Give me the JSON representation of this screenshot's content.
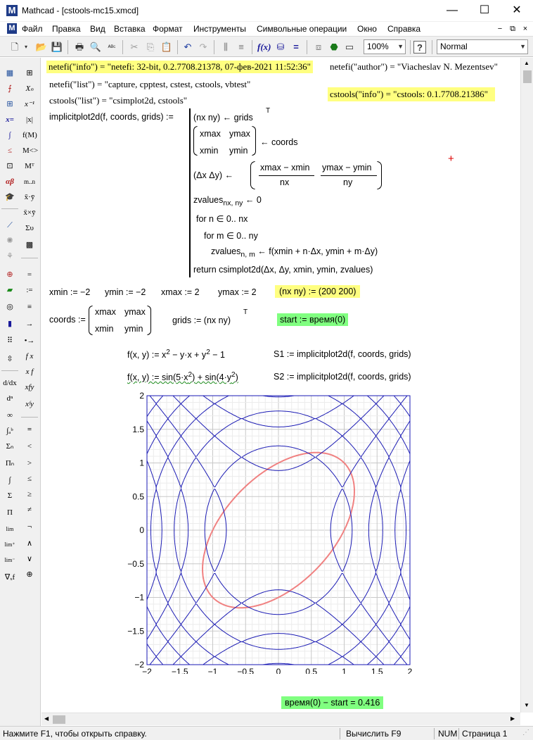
{
  "window": {
    "title": "Mathcad - [cstools-mc15.xmcd]",
    "app_icon": "M",
    "doc_icon": "M",
    "minimize": "—",
    "maximize": "☐",
    "close": "✕"
  },
  "menu": [
    "Файл",
    "Правка",
    "Вид",
    "Вставка",
    "Формат",
    "Инструменты",
    "Символьные операции",
    "Окно",
    "Справка"
  ],
  "toolbar": {
    "zoom": "100%",
    "style": "Normal"
  },
  "worksheet": {
    "netefi_info": "netefi(\"info\") = \"netefi: 32-bit, 0.2.7708.21378, 07-фев-2021 11:52:36\"",
    "netefi_author": "netefi(\"author\") = \"Viacheslav N. Mezentsev\"",
    "netefi_list": "netefi(\"list\") = \"capture, cpptest, cstest, cstools, vbtest\"",
    "cstools_info": "cstools(\"info\") = \"cstools: 0.1.7708.21386\"",
    "cstools_list": "cstools(\"list\") = \"csimplot2d, cstools\"",
    "fn_def": "implicitplot2d(f, coords, grids) :=",
    "prog": {
      "l1": "(nx   ny) ← grids",
      "l1_sup": "T",
      "m_xmax": "xmax",
      "m_ymax": "ymax",
      "m_xmin": "xmin",
      "m_ymin": "ymin",
      "coords_arrow": "← coords",
      "l3_left": "(Δx   Δy) ←",
      "l3_n1": "xmax − xmin",
      "l3_d1": "nx",
      "l3_n2": "ymax − ymin",
      "l3_d2": "ny",
      "l4": "zvalues",
      "l4_sub": "nx, ny",
      "l4_rest": " ← 0",
      "l5": "for   n ∈ 0.. nx",
      "l6": "for   m ∈ 0.. ny",
      "l7": "zvalues",
      "l7_sub": "n, m",
      "l7_rest": " ← f(xmin + n·Δx, ymin + m·Δy)",
      "l8": "return   csimplot2d(Δx, Δy, xmin, ymin, zvalues)"
    },
    "xmin": "xmin := −2",
    "ymin": "ymin := −2",
    "xmax": "xmax := 2",
    "ymax": "ymax := 2",
    "nxny": "(nx   ny) := (200   200)",
    "coords_lhs": "coords :=",
    "grids": "grids := (nx   ny)",
    "grids_sup": "T",
    "start": "start := время(0)",
    "f1": "f(x, y) := x",
    "f1_sup1": "2",
    "f1_mid": " − y·x + y",
    "f1_sup2": "2",
    "f1_end": " − 1",
    "s1": "S1 := implicitplot2d(f, coords, grids)",
    "f2": "f(x, y) := sin",
    "f2_a": "5·x",
    "f2_sup1": "2",
    "f2_mid": " + sin",
    "f2_b": "4·y",
    "f2_sup2": "2",
    "s2": "S2 := implicitplot2d(f, coords, grids)",
    "elapsed": "время(0) − start = 0.416"
  },
  "chart_data": {
    "type": "line",
    "title": "",
    "xlabel": "",
    "ylabel": "",
    "xlim": [
      -2,
      2
    ],
    "ylim": [
      -2,
      2
    ],
    "grid": true,
    "xticks": [
      "−2",
      "−1.5",
      "−1",
      "−0.5",
      "0",
      "0.5",
      "1",
      "1.5",
      "2"
    ],
    "yticks": [
      "2",
      "1.5",
      "1",
      "0.5",
      "0",
      "−0.5",
      "−1",
      "−1.5",
      "−2"
    ],
    "series": [
      {
        "equation": "x^2 − x·y + y^2 = 1",
        "color": "#f08080"
      },
      {
        "equation": "sin(5·x^2) + sin(4·y^2) = 0",
        "color": "#1a1ab4"
      }
    ]
  },
  "status": {
    "help": "Нажмите F1, чтобы открыть справку.",
    "calc": "Вычислить F9",
    "num": "NUM",
    "page": "Страница 1"
  },
  "colors": {
    "highlight_yellow": "#ffff80",
    "highlight_green": "#80ff80",
    "curve_blue": "#1a1ab4",
    "curve_red": "#f08080"
  }
}
